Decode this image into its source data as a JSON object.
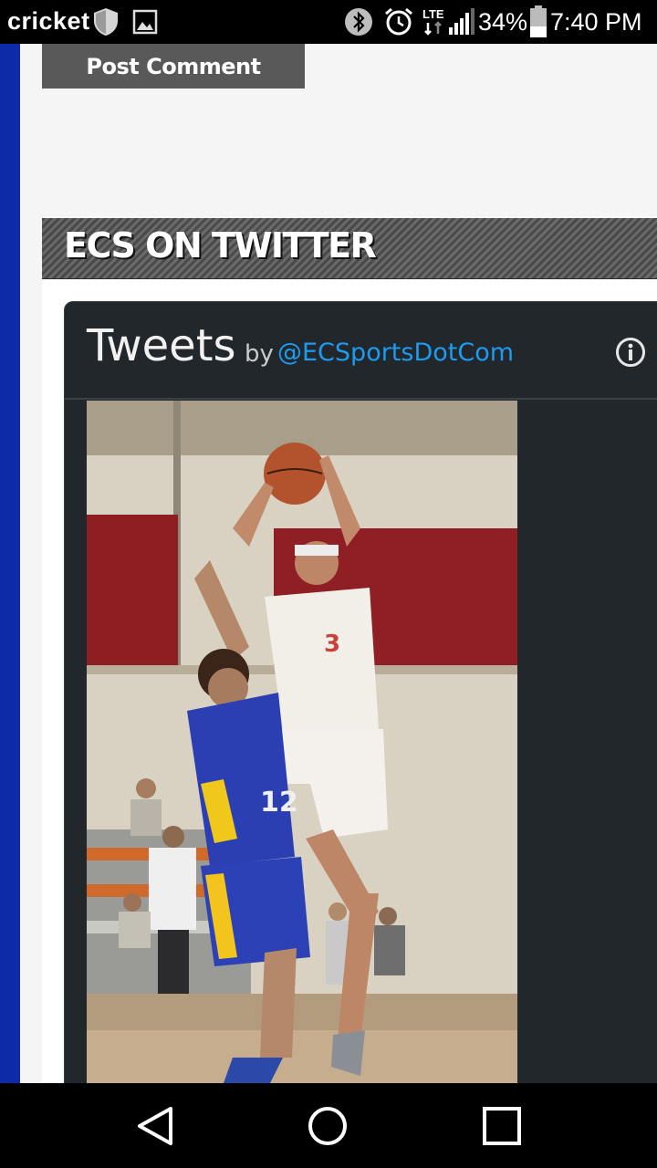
{
  "status_bar": {
    "carrier": "cricket",
    "battery_percent": "34%",
    "time": "7:40 PM",
    "network": "LTE",
    "icons": [
      "shield-icon",
      "image-icon",
      "bluetooth-icon",
      "alarm-icon",
      "lte-icon",
      "signal-icon",
      "battery-icon"
    ]
  },
  "comment_form": {
    "post_button_label": "Post Comment"
  },
  "twitter_widget": {
    "section_title": "ECS ON TWITTER",
    "timeline_title": "Tweets",
    "by_label": "by",
    "handle": "@ECSportsDotCom",
    "info_icon": "info-icon"
  },
  "navigation": {
    "icons": [
      "back-icon",
      "home-icon",
      "recents-icon"
    ]
  },
  "colors": {
    "accent_blue_stripe": "#0d2aa8",
    "twitter_link": "#1d9bf0",
    "timeline_bg": "#22272c"
  }
}
